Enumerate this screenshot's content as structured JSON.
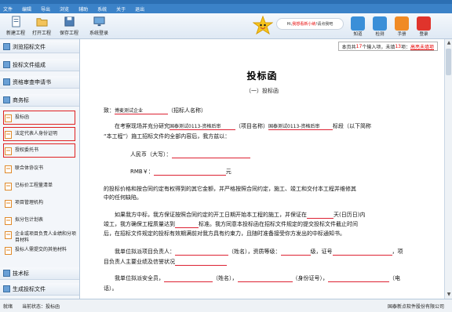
{
  "menu": [
    "文件",
    "编辑",
    "导出",
    "浏览",
    "辅助",
    "系统",
    "关于",
    "退出"
  ],
  "toolbar": {
    "items": [
      "新建工程",
      "打开工程",
      "保存工程",
      "系统登录"
    ],
    "bubble_prefix": "Hi,",
    "bubble_link": "我想看新小纳",
    "bubble_suffix": "!请点我吧",
    "right_buttons": [
      "知道",
      "检测",
      "手册",
      "登录"
    ],
    "right_colors": [
      "#3a8fd8",
      "#3a8fd8",
      "#f08a24",
      "#e0342c"
    ]
  },
  "sidebar": {
    "sections": [
      "浏览招标文件",
      "投标文件组成",
      "资格审查申请书",
      "商务标",
      "技术标",
      "生成投标文件"
    ],
    "items": [
      "投标函",
      "法定代表人身份证明",
      "授权委托书",
      "联合体协议书",
      "已标价工程量清单",
      "项目管理机构",
      "拟分包计划表",
      "企业或项目负责人业绩和分项目材料",
      "投标人需提交的其他材料"
    ]
  },
  "page_info": {
    "prefix": "本页共",
    "total": "17",
    "mid": "个输入项，未填",
    "unfilled": "13",
    "suffix": "项：",
    "link": "高亮未填项"
  },
  "doc": {
    "title": "投标函",
    "subtitle": "（一）投标函",
    "to_prefix": "致：",
    "to_value": "博麦测试企业",
    "to_suffix": "（招标人名称）",
    "p1_a": "在考察现场并充分研究",
    "p1_project": "国泰测试0113-资格后审",
    "p1_b": "（项目名称）",
    "p1_project2": "国泰测试0113-资格后审",
    "p1_c": "标段（以下简称",
    "p1_line2": "“本工程”）施工招标文件的全部内容后，我方兹以：",
    "rmb_label": "人民币（大写）：",
    "rmb_small": "RMB￥：",
    "rmb_unit": "元",
    "p2_l1": "的投标价格和按合同约定有权得到的其它金额，并严格按照合同约定，施工、竣工和交付本工程并维修其",
    "p2_l2": "中的任何缺陷。",
    "p3_a": "如果我方中标，我方保证按照合同约定的开工日期开始本工程的施工，并保证在",
    "p3_b": "天(日历日)内",
    "p3_l2a": "竣工，我方确保工程质量达到",
    "p3_l2b": "标准。我方同意本投标函在招标文件规定的提交投标文件截止时间",
    "p3_l3": "后，在招标文件规定的投标有效期满前对我方具有约束力，且随时准备接受你方发出的中标通知书。",
    "p4_a": "我单位拟派项目负责人：",
    "p4_b": "（姓名），资质等级：",
    "p4_c": "级，证号",
    "p4_d": "，项",
    "p4_l2": "目负责人主要业绩及信誉状况",
    "p5_a": "我单位拟派安全员，",
    "p5_b": "（姓名），",
    "p5_c": "（身份证号），",
    "p5_d": "（电",
    "p5_l2": "话）。"
  },
  "status": {
    "ready": "就绪",
    "current_label": "当前状态：",
    "current_value": "投标函",
    "copyright": "国泰新点软件股份有限公司"
  }
}
